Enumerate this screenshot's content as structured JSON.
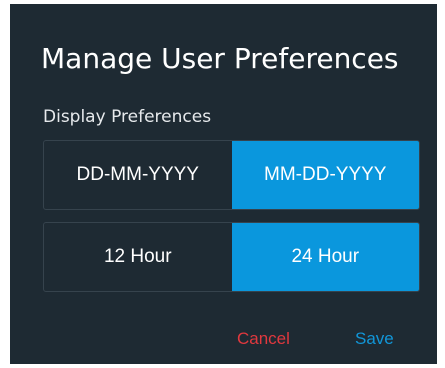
{
  "dialog": {
    "title": "Manage User Preferences",
    "section_label": "Display Preferences",
    "date_format": {
      "options": [
        "DD-MM-YYYY",
        "MM-DD-YYYY"
      ],
      "selected": "MM-DD-YYYY"
    },
    "time_format": {
      "options": [
        "12 Hour",
        "24 Hour"
      ],
      "selected": "24 Hour"
    },
    "actions": {
      "cancel_label": "Cancel",
      "save_label": "Save"
    }
  },
  "colors": {
    "dialog_background": "#1e2a33",
    "selected_segment": "#0a97dd",
    "cancel": "#e0383e",
    "save": "#1196d8"
  }
}
